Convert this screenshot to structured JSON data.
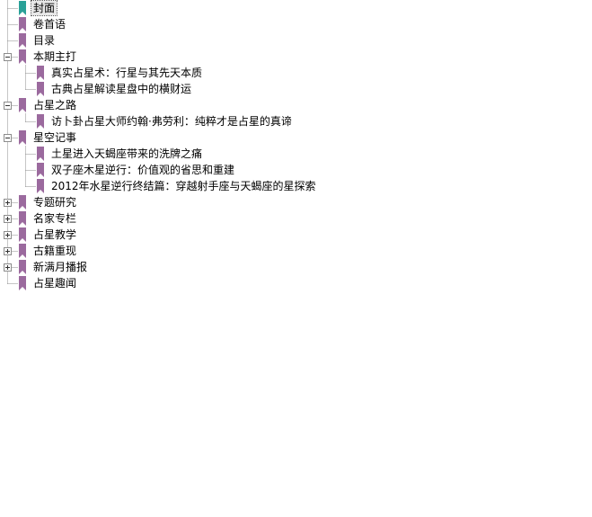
{
  "colors": {
    "bookmark": "#9b6a9e",
    "bookmark_selected": "#2aa198",
    "tree_lines": "#8c8c8c"
  },
  "icons": {
    "bookmark": "bookmark-icon",
    "expand": "plus-box-icon",
    "collapse": "minus-box-icon"
  },
  "selected_index": 0,
  "tree": [
    {
      "label": "封面"
    },
    {
      "label": "卷首语"
    },
    {
      "label": "目录"
    },
    {
      "label": "本期主打",
      "expanded": true,
      "children": [
        {
          "label": "真实占星术：行星与其先天本质"
        },
        {
          "label": "古典占星解读星盘中的横财运"
        }
      ]
    },
    {
      "label": "占星之路",
      "expanded": true,
      "children": [
        {
          "label": "访卜卦占星大师约翰·弗劳利：纯粹才是占星的真谛"
        }
      ]
    },
    {
      "label": "星空记事",
      "expanded": true,
      "children": [
        {
          "label": "土星进入天蝎座带来的洗牌之痛"
        },
        {
          "label": "双子座木星逆行：价值观的省思和重建"
        },
        {
          "label": "2012年水星逆行终结篇：穿越射手座与天蝎座的星探索"
        }
      ]
    },
    {
      "label": "专题研究",
      "expanded": false,
      "collapsed_children": true
    },
    {
      "label": "名家专栏",
      "expanded": false,
      "collapsed_children": true
    },
    {
      "label": "占星教学",
      "expanded": false,
      "collapsed_children": true
    },
    {
      "label": "古籍重现",
      "expanded": false,
      "collapsed_children": true
    },
    {
      "label": "新满月播报",
      "expanded": false,
      "collapsed_children": true
    },
    {
      "label": "占星趣闻"
    }
  ]
}
